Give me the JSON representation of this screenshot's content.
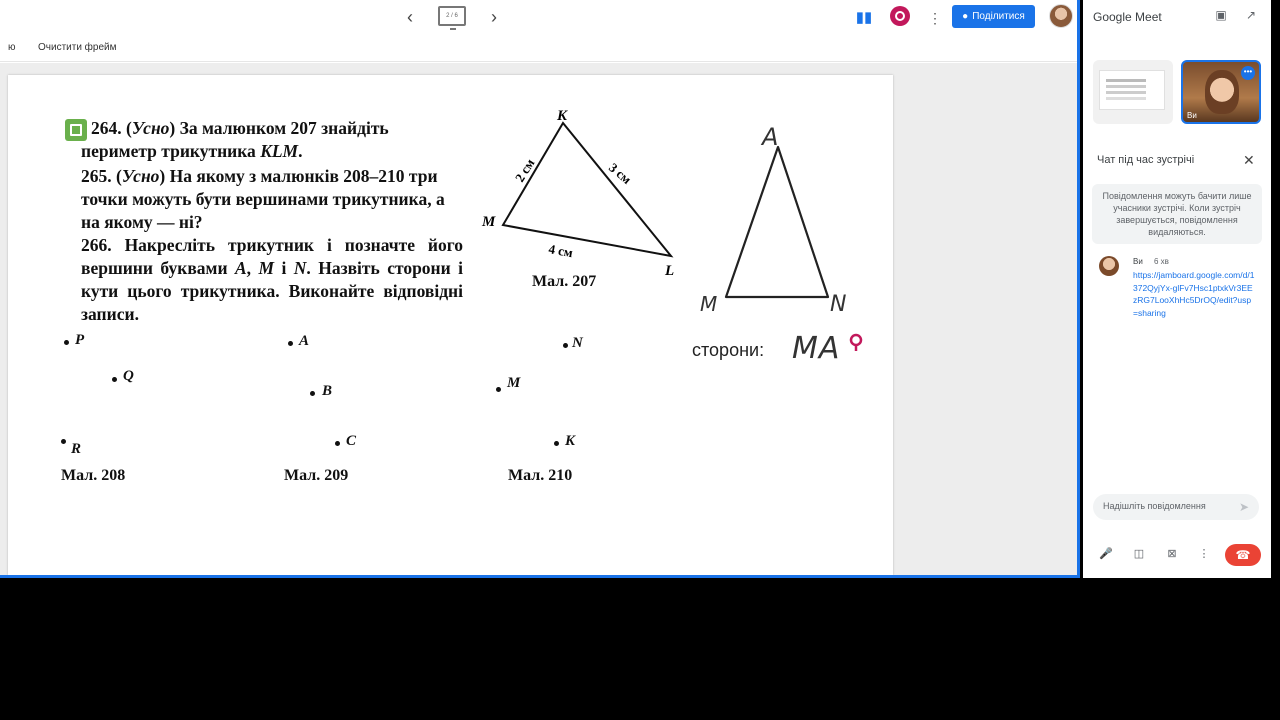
{
  "jamboard": {
    "prev_arrow": "‹",
    "next_arrow": "›",
    "frame_indicator": "2 / 6",
    "left_clip_text": "ю",
    "clear_frame_label": "Очистити фрейм",
    "share_label": "Поділитися",
    "more_label": "⋮",
    "meet_icon": "▮▮"
  },
  "page": {
    "p264_num": "264.",
    "p264_text_a": "(",
    "p264_oral": "Усно",
    "p264_text_b": ") За малюнком 207 знайдіть периметр трикутника ",
    "p264_klm": "KLM",
    "p264_end": ".",
    "p265_num": "265.",
    "p265_oral": "Усно",
    "p265_text": ") На якому з малюнків 208–210 три точки можуть бути вершинами трикутника, а на якому — ні?",
    "p266_num": "266.",
    "p266_text_a": "Накресліть трикутник і позначте його вершини буквами ",
    "p266_a": "A",
    "p266_m": "M",
    "p266_i": "і",
    "p266_n": "N",
    "p266_text_b": ". Назвіть сторони і кути цього трикутника. Виконайте відповідні записи.",
    "fig207": "Мал. 207",
    "fig208": "Мал. 208",
    "fig209": "Мал. 209",
    "fig210": "Мал. 210",
    "tri_K": "K",
    "tri_L": "L",
    "tri_M": "M",
    "side_km": "2 см",
    "side_kl": "3 см",
    "side_ml": "4 см",
    "pts208": [
      "P",
      "Q",
      "R"
    ],
    "pts209": [
      "A",
      "B",
      "C"
    ],
    "pts210": [
      "N",
      "M",
      "K"
    ],
    "hand_A": "A",
    "hand_M": "M",
    "hand_N": "N",
    "sides_label": "сторони:",
    "hand_sides": "MA"
  },
  "meet": {
    "title": "Google Meet",
    "self_name": "Ви",
    "self_menu": "•••",
    "chat_title": "Чат під час зустрічі",
    "chat_close": "✕",
    "notice": "Повідомлення можуть бачити лише учасники зустрічі. Коли зустріч завершується, повідомлення видаляються.",
    "msg_sender": "Ви",
    "msg_time": "6 хв",
    "msg_text": "https://jamboard.google.com/d/1372QyjYx-glFv7Hsc1ptxkVr3EEzRG7LooXhHc5DrOQ/edit?usp=sharing",
    "input_placeholder": "Надішліть повідомлення",
    "send_icon": "➤"
  },
  "colors": {
    "accent": "#1a73e8",
    "hangup": "#ea4335",
    "record": "#c2185b",
    "pen": "#333333",
    "marker": "#c2185b"
  }
}
